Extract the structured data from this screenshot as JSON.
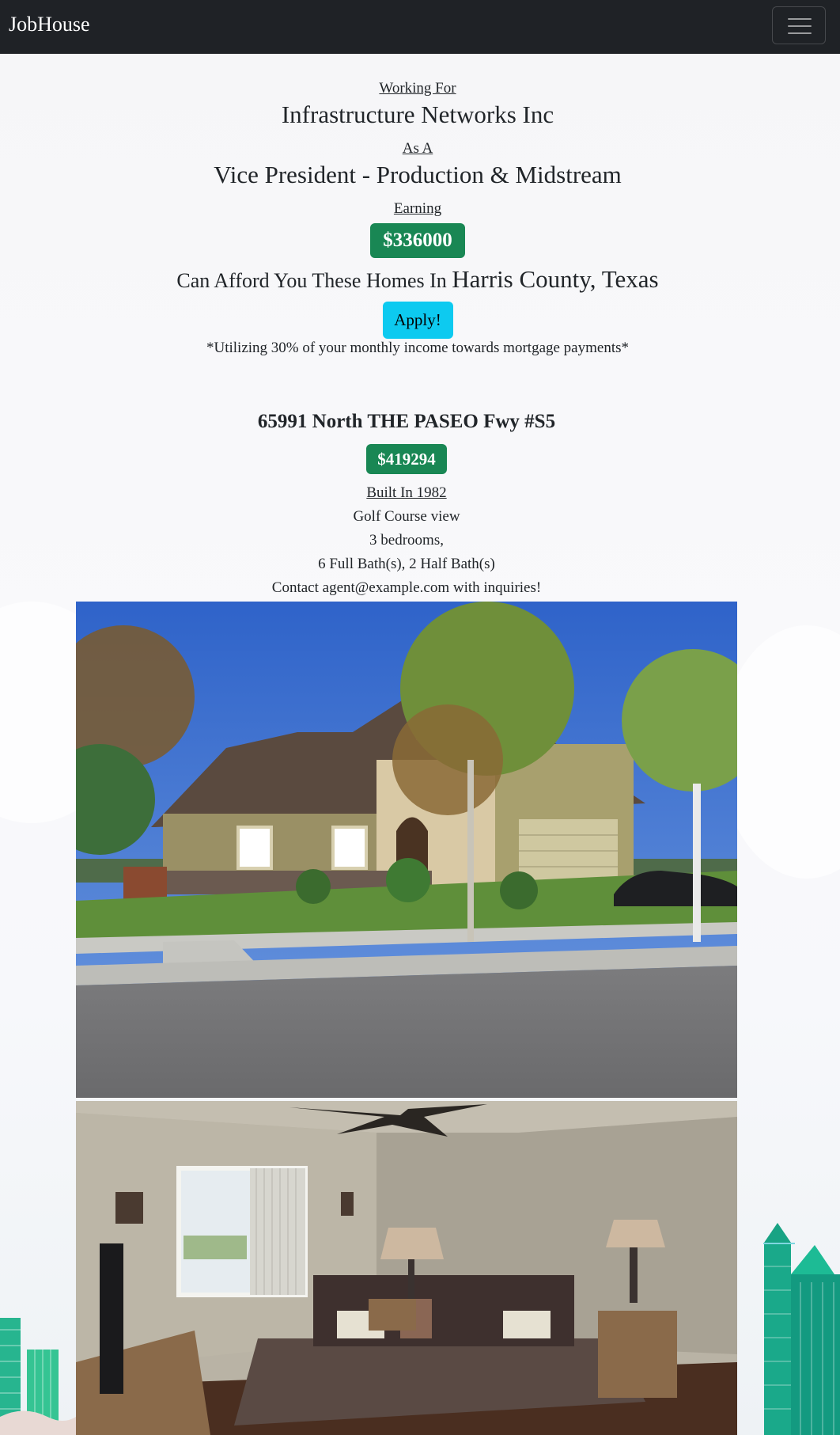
{
  "navbar": {
    "brand": "JobHouse",
    "menu_icon": "hamburger-menu-icon"
  },
  "header": {
    "working_for_label": "Working For",
    "company": "Infrastructure Networks Inc",
    "as_a_label": "As A",
    "job_title": "Vice President - Production & Midstream",
    "earning_label": "Earning",
    "salary": "$336000",
    "afford_text": "Can Afford You These Homes In",
    "location": "Harris County, Texas",
    "apply_label": "Apply!",
    "note": "*Utilizing 30% of your monthly income towards mortgage payments*"
  },
  "listing": {
    "address": "65991 North THE PASEO Fwy #S5",
    "price": "$419294",
    "built": "Built In 1982",
    "view": "Golf Course view",
    "bedrooms": "3 bedrooms,",
    "baths": "6 Full Bath(s), 2 Half Bath(s)",
    "contact": "Contact agent@example.com with inquiries!"
  },
  "colors": {
    "navbar_bg": "#1f2226",
    "badge_green": "#198754",
    "apply_cyan": "#0dcaf0",
    "skyline_teal": "#1aa98a"
  }
}
